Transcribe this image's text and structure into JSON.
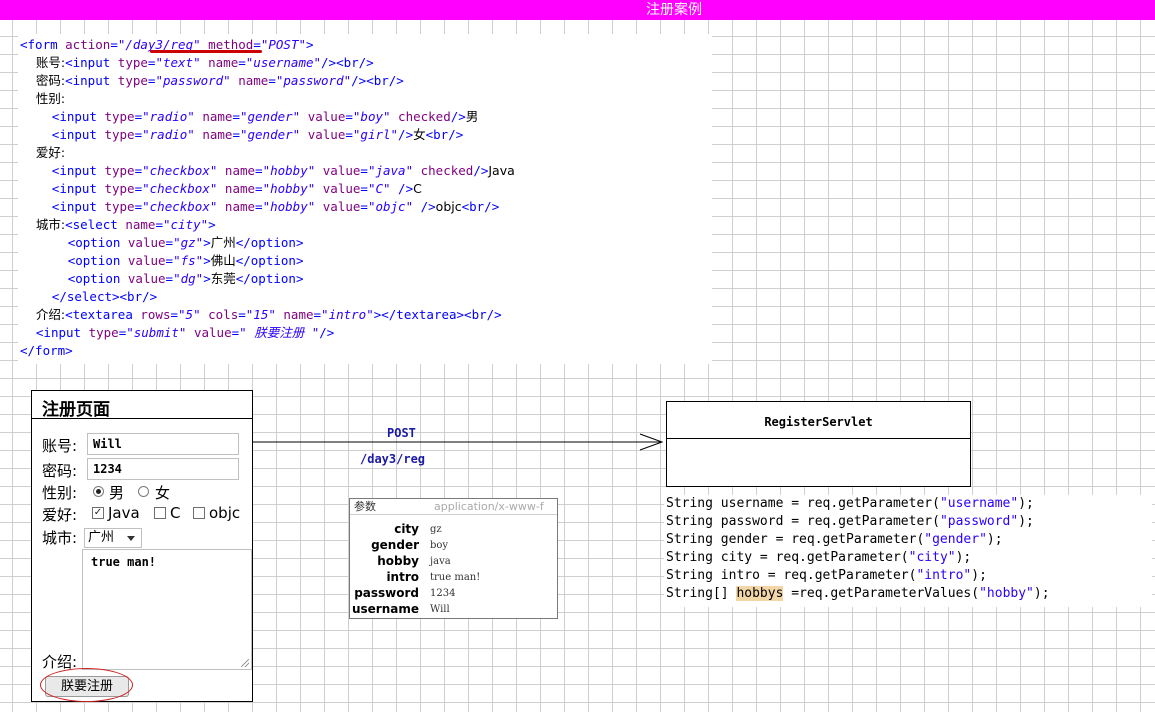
{
  "header": {
    "title": "注册案例"
  },
  "html_code": {
    "lines": [
      [
        [
          "tag",
          "<form "
        ],
        [
          "attr",
          "action"
        ],
        [
          "tag",
          "="
        ],
        [
          "val",
          "\"/day3/reg\""
        ],
        [
          "attr",
          " method"
        ],
        [
          "tag",
          "="
        ],
        [
          "val",
          "\"POST\""
        ],
        [
          "tag",
          ">"
        ]
      ],
      [
        [
          "txt",
          "    账号:"
        ],
        [
          "tag",
          "<input "
        ],
        [
          "attr",
          "type"
        ],
        [
          "tag",
          "="
        ],
        [
          "val",
          "\"text\""
        ],
        [
          "attr",
          " name"
        ],
        [
          "tag",
          "="
        ],
        [
          "val",
          "\"username\""
        ],
        [
          "tag",
          "/><br/>"
        ]
      ],
      [
        [
          "txt",
          "    密码:"
        ],
        [
          "tag",
          "<input "
        ],
        [
          "attr",
          "type"
        ],
        [
          "tag",
          "="
        ],
        [
          "val",
          "\"password\""
        ],
        [
          "attr",
          " name"
        ],
        [
          "tag",
          "="
        ],
        [
          "val",
          "\"password\""
        ],
        [
          "tag",
          "/><br/>"
        ]
      ],
      [
        [
          "txt",
          "    性别:"
        ]
      ],
      [
        [
          "txt",
          "        "
        ],
        [
          "tag",
          "<input "
        ],
        [
          "attr",
          "type"
        ],
        [
          "tag",
          "="
        ],
        [
          "val",
          "\"radio\""
        ],
        [
          "attr",
          " name"
        ],
        [
          "tag",
          "="
        ],
        [
          "val",
          "\"gender\""
        ],
        [
          "attr",
          " value"
        ],
        [
          "tag",
          "="
        ],
        [
          "val",
          "\"boy\""
        ],
        [
          "attr",
          " checked"
        ],
        [
          "tag",
          "/>"
        ],
        [
          "txt",
          "男"
        ]
      ],
      [
        [
          "txt",
          "        "
        ],
        [
          "tag",
          "<input "
        ],
        [
          "attr",
          "type"
        ],
        [
          "tag",
          "="
        ],
        [
          "val",
          "\"radio\""
        ],
        [
          "attr",
          " name"
        ],
        [
          "tag",
          "="
        ],
        [
          "val",
          "\"gender\""
        ],
        [
          "attr",
          " value"
        ],
        [
          "tag",
          "="
        ],
        [
          "val",
          "\"girl\""
        ],
        [
          "tag",
          "/>"
        ],
        [
          "txt",
          "女"
        ],
        [
          "tag",
          "<br/>"
        ]
      ],
      [
        [
          "txt",
          "    爱好:"
        ]
      ],
      [
        [
          "txt",
          "        "
        ],
        [
          "tag",
          "<input "
        ],
        [
          "attr",
          "type"
        ],
        [
          "tag",
          "="
        ],
        [
          "val",
          "\"checkbox\""
        ],
        [
          "attr",
          " name"
        ],
        [
          "tag",
          "="
        ],
        [
          "val",
          "\"hobby\""
        ],
        [
          "attr",
          " value"
        ],
        [
          "tag",
          "="
        ],
        [
          "val",
          "\"java\""
        ],
        [
          "attr",
          " checked"
        ],
        [
          "tag",
          "/>"
        ],
        [
          "txt",
          "Java"
        ]
      ],
      [
        [
          "txt",
          "        "
        ],
        [
          "tag",
          "<input "
        ],
        [
          "attr",
          "type"
        ],
        [
          "tag",
          "="
        ],
        [
          "val",
          "\"checkbox\""
        ],
        [
          "attr",
          " name"
        ],
        [
          "tag",
          "="
        ],
        [
          "val",
          "\"hobby\""
        ],
        [
          "attr",
          " value"
        ],
        [
          "tag",
          "="
        ],
        [
          "val",
          "\"C\""
        ],
        [
          "tag",
          " />"
        ],
        [
          "txt",
          "C"
        ]
      ],
      [
        [
          "txt",
          "        "
        ],
        [
          "tag",
          "<input "
        ],
        [
          "attr",
          "type"
        ],
        [
          "tag",
          "="
        ],
        [
          "val",
          "\"checkbox\""
        ],
        [
          "attr",
          " name"
        ],
        [
          "tag",
          "="
        ],
        [
          "val",
          "\"hobby\""
        ],
        [
          "attr",
          " value"
        ],
        [
          "tag",
          "="
        ],
        [
          "val",
          "\"objc\""
        ],
        [
          "tag",
          " />"
        ],
        [
          "txt",
          "objc"
        ],
        [
          "tag",
          "<br/>"
        ]
      ],
      [
        [
          "txt",
          "    城市:"
        ],
        [
          "tag",
          "<select "
        ],
        [
          "attr",
          "name"
        ],
        [
          "tag",
          "="
        ],
        [
          "val",
          "\"city\""
        ],
        [
          "tag",
          ">"
        ]
      ],
      [
        [
          "txt",
          "            "
        ],
        [
          "tag",
          "<option "
        ],
        [
          "attr",
          "value"
        ],
        [
          "tag",
          "="
        ],
        [
          "val",
          "\"gz\""
        ],
        [
          "tag",
          ">"
        ],
        [
          "txt",
          "广州"
        ],
        [
          "tag",
          "</option>"
        ]
      ],
      [
        [
          "txt",
          "            "
        ],
        [
          "tag",
          "<option "
        ],
        [
          "attr",
          "value"
        ],
        [
          "tag",
          "="
        ],
        [
          "val",
          "\"fs\""
        ],
        [
          "tag",
          ">"
        ],
        [
          "txt",
          "佛山"
        ],
        [
          "tag",
          "</option>"
        ]
      ],
      [
        [
          "txt",
          "            "
        ],
        [
          "tag",
          "<option "
        ],
        [
          "attr",
          "value"
        ],
        [
          "tag",
          "="
        ],
        [
          "val",
          "\"dg\""
        ],
        [
          "tag",
          ">"
        ],
        [
          "txt",
          "东莞"
        ],
        [
          "tag",
          "</option>"
        ]
      ],
      [
        [
          "txt",
          "        "
        ],
        [
          "tag",
          "</select><br/>"
        ]
      ],
      [
        [
          "txt",
          "    介绍:"
        ],
        [
          "tag",
          "<textarea "
        ],
        [
          "attr",
          "rows"
        ],
        [
          "tag",
          "="
        ],
        [
          "val",
          "\"5\""
        ],
        [
          "attr",
          " cols"
        ],
        [
          "tag",
          "="
        ],
        [
          "val",
          "\"15\""
        ],
        [
          "attr",
          " name"
        ],
        [
          "tag",
          "="
        ],
        [
          "val",
          "\"intro\""
        ],
        [
          "tag",
          "></textarea><br/>"
        ]
      ],
      [
        [
          "txt",
          "    "
        ],
        [
          "tag",
          "<input "
        ],
        [
          "attr",
          "type"
        ],
        [
          "tag",
          "="
        ],
        [
          "val",
          "\"submit\""
        ],
        [
          "attr",
          " value"
        ],
        [
          "tag",
          "="
        ],
        [
          "val",
          "\" 朕要注册 \""
        ],
        [
          "tag",
          "/>"
        ]
      ],
      [
        [
          "tag",
          "</form>"
        ]
      ]
    ]
  },
  "form": {
    "title": "注册页面",
    "username_label": "账号:",
    "username_value": "Will",
    "password_label": "密码:",
    "password_value": "1234",
    "gender_label": "性别:",
    "gender_male": "男",
    "gender_female": "女",
    "hobby_label": "爱好:",
    "hobby_java": "Java",
    "hobby_c": "C",
    "hobby_objc": "objc",
    "city_label": "城市:",
    "city_value": "广州",
    "intro_value": "true man!",
    "intro_label": "介绍:",
    "submit_label": "朕要注册"
  },
  "request": {
    "method": "POST",
    "path": "/day3/reg"
  },
  "servlet": {
    "name": "RegisterServlet"
  },
  "servlet_code": {
    "lines": [
      [
        [
          "t",
          "String username = req.getParameter("
        ],
        [
          "s",
          "\"username\""
        ],
        [
          "t",
          ");"
        ]
      ],
      [
        [
          "t",
          "String password = req.getParameter("
        ],
        [
          "s",
          "\"password\""
        ],
        [
          "t",
          ");"
        ]
      ],
      [
        [
          "t",
          "String gender = req.getParameter("
        ],
        [
          "s",
          "\"gender\""
        ],
        [
          "t",
          ");"
        ]
      ],
      [
        [
          "t",
          "String city = req.getParameter("
        ],
        [
          "s",
          "\"city\""
        ],
        [
          "t",
          ");"
        ]
      ],
      [
        [
          "t",
          "String intro = req.getParameter("
        ],
        [
          "s",
          "\"intro\""
        ],
        [
          "t",
          ");"
        ]
      ],
      [
        [
          "t",
          "String[] "
        ],
        [
          "h",
          "hobbys"
        ],
        [
          "t",
          " =req.getParameterValues("
        ],
        [
          "s",
          "\"hobby\""
        ],
        [
          "t",
          ");"
        ]
      ]
    ]
  },
  "params": {
    "header_left": "参数",
    "header_right": "application/x-www-f",
    "rows": [
      {
        "key": "city",
        "value": "gz"
      },
      {
        "key": "gender",
        "value": "boy"
      },
      {
        "key": "hobby",
        "value": "java"
      },
      {
        "key": "intro",
        "value": "true man!"
      },
      {
        "key": "password",
        "value": "1234"
      },
      {
        "key": "username",
        "value": "Will"
      }
    ]
  },
  "colors": {
    "accent_bar": "#ff00ff",
    "annotation_red": "#cc0000",
    "highlight": "#f2d6a8"
  }
}
